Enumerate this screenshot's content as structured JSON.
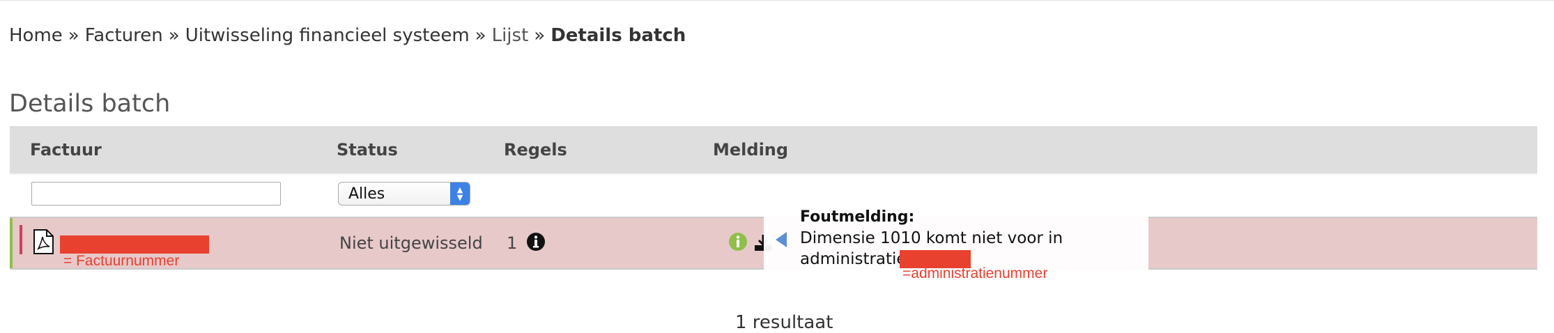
{
  "breadcrumb": {
    "home": "Home",
    "facturen": "Facturen",
    "uitwisseling": "Uitwisseling financieel systeem",
    "lijst": "Lijst",
    "current": "Details batch",
    "separator": "»"
  },
  "page": {
    "title": "Details batch"
  },
  "table": {
    "columns": {
      "factuur": "Factuur",
      "status": "Status",
      "regels": "Regels",
      "melding": "Melding"
    },
    "filters": {
      "factuur_value": "",
      "status_selected": "Alles"
    },
    "rows": [
      {
        "factuur": "",
        "factuur_annotation": "= Factuurnummer",
        "status": "Niet uitgewisseld",
        "regels": "1"
      }
    ]
  },
  "tooltip": {
    "title": "Foutmelding:",
    "line1": "Dimensie 1010 komt niet voor in",
    "line2_prefix": "administratie",
    "annotation": "=administratienummer"
  },
  "pagination": {
    "text": "1 resultaat"
  },
  "colors": {
    "header_bg": "#dedede",
    "error_row_bg": "#e8c9ca",
    "redaction": "#e8412f",
    "select_accent": "#3b82e4",
    "info_green": "#8fbf4a"
  },
  "icons": {
    "pdf": "pdf-icon",
    "info": "info-icon",
    "green_info": "green-info-icon",
    "download": "download-icon",
    "tip_arrow": "tooltip-arrow-icon"
  }
}
